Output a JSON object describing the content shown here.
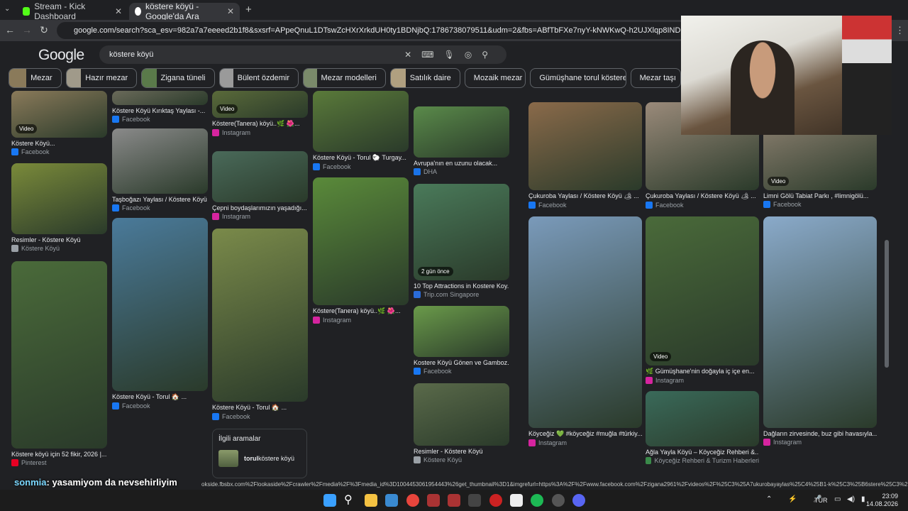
{
  "tabs": [
    {
      "label": "Stream - Kick Dashboard",
      "favicon_color": "#53fc18"
    },
    {
      "label": "köstere köyü - Google'da Ara",
      "favicon_color": "#ffffff"
    }
  ],
  "address": {
    "url": "google.com/search?sca_esv=982a7a7eeeed2b1f8&sxsrf=APpeQnuL1DTswZcHXrXrkdUH0ty1BDNjbQ:1786738079511&udm=2&fbs=ABfTbFXe7nyY-kNWKwQ-h2UJXlqp8INDCM9bT64ZSPFlq12ABgHn6ltrUBOgN"
  },
  "google": {
    "logo": "Google",
    "query": "köstere köyü"
  },
  "chips": [
    {
      "label": "Mezar",
      "color": "#8a7a5a"
    },
    {
      "label": "Hazır mezar",
      "color": "#a09a8a"
    },
    {
      "label": "Zigana tüneli",
      "color": "#5a7a4a"
    },
    {
      "label": "Bülent özdemir",
      "color": "#9a9a9a"
    },
    {
      "label": "Mezar modelleri",
      "color": "#7a8a6a"
    },
    {
      "label": "Satılık daire",
      "color": "#b0a080"
    },
    {
      "label": "Mozaik mezar",
      "color": ""
    },
    {
      "label": "Gümüşhane torul köstere",
      "color": ""
    },
    {
      "label": "Mezar taşı",
      "color": ""
    }
  ],
  "results": [
    {
      "title": "Köstere Köyü...",
      "source": "Facebook",
      "badge": "Video",
      "src_color": "#1877f2",
      "bg": "#8a7a5a"
    },
    {
      "title": "Resimler - Köstere Köyü",
      "source": "Köstere Köyü",
      "badge": "",
      "src_color": "#9aa0a6",
      "bg": "#7a8a3a"
    },
    {
      "title": "Köstere köyü için 52 fikir, 2026 |...",
      "source": "Pinterest",
      "badge": "",
      "src_color": "#e60023",
      "bg": "#4a6a3a"
    },
    {
      "title": "Köstere Köyü Kırıktaş Yaylası -...",
      "source": "Facebook",
      "badge": "",
      "src_color": "#1877f2",
      "bg": "#6a6a5a"
    },
    {
      "title": "Taşboğazı Yaylası / Köstere Köyü ...",
      "source": "Facebook",
      "badge": "",
      "src_color": "#1877f2",
      "bg": "#8a8a8a"
    },
    {
      "title": "Köstere Köyü - Torul 🏠 ...",
      "source": "Facebook",
      "badge": "",
      "src_color": "#1877f2",
      "bg": "#4a7a9a"
    },
    {
      "title": "Köstere(Tanera) köyü..🌿 🌺...",
      "source": "Instagram",
      "badge": "Video",
      "src_color": "#d6249f",
      "bg": "#5a6a3a"
    },
    {
      "title": "Çepni boydaşlarımızın yaşadığı...",
      "source": "Instagram",
      "badge": "",
      "src_color": "#d6249f",
      "bg": "#4a6a5a"
    },
    {
      "title": "Köstere Köyü - Torul 🏠 ...",
      "source": "Facebook",
      "badge": "",
      "src_color": "#1877f2",
      "bg": "#7a8a4a"
    },
    {
      "title": "Köstere Köyü - Torul 🐑 Turgay...",
      "source": "Facebook",
      "badge": "",
      "src_color": "#1877f2",
      "bg": "#5a7a3a"
    },
    {
      "title": "Köstere(Tanera) köyü..🌿 🌺...",
      "source": "Instagram",
      "badge": "",
      "src_color": "#d6249f",
      "bg": "#5a8a3a"
    },
    {
      "title": "Avrupa'nın en uzunu olacak...",
      "source": "DHA",
      "badge": "",
      "src_color": "#1a73e8",
      "bg": "#5a8a4a"
    },
    {
      "title": "10 Top Attractions in Kostere Koy...",
      "source": "Trip.com Singapore",
      "badge": "2 gün önce",
      "src_color": "#2a6bd9",
      "bg": "#4a7a5a"
    },
    {
      "title": "Kostere Köyü Gönen ve Gamboz...",
      "source": "Facebook",
      "badge": "",
      "src_color": "#1877f2",
      "bg": "#6a9a4a"
    },
    {
      "title": "Resimler - Köstere Köyü",
      "source": "Köstere Köyü",
      "badge": "",
      "src_color": "#9aa0a6",
      "bg": "#5a6a4a"
    },
    {
      "title": "Çukuroba Yaylası / Köstere Köyü 🏕 ...",
      "source": "Facebook",
      "badge": "",
      "src_color": "#1877f2",
      "bg": "#8a6a4a"
    },
    {
      "title": "Köyceğiz 💚 #köyceğiz #muğla #türkiy...",
      "source": "Instagram",
      "badge": "",
      "src_color": "#d6249f",
      "bg": "#7a9aba"
    },
    {
      "title": "Çukuroba Yaylası / Köstere Köyü 🏕 ...",
      "source": "Facebook",
      "badge": "",
      "src_color": "#1877f2",
      "bg": "#9a8a7a"
    },
    {
      "title": "🌿 Gümüşhane'nin doğayla iç içe en...",
      "source": "Instagram",
      "badge": "Video",
      "src_color": "#d6249f",
      "bg": "#4a6a3a"
    },
    {
      "title": "Ağla Yayla Köyü – Köyceğiz Rehberi &...",
      "source": "Köyceğiz Rehberi & Turizm Haberleri",
      "badge": "",
      "src_color": "#3a8a4a",
      "bg": "#3a6a5a"
    },
    {
      "title": "Limni Gölü Tabiat Parkı , #limnigölü...",
      "source": "Facebook",
      "badge": "Video",
      "src_color": "#1877f2",
      "bg": "#9a8a7a"
    },
    {
      "title": "Dağların zirvesinde, buz gibi havasıyla...",
      "source": "Instagram",
      "badge": "",
      "src_color": "#d6249f",
      "bg": "#8aaaca"
    }
  ],
  "related": {
    "heading": "İlgili aramalar",
    "item_bold": "torul",
    "item_rest": " köstere köyü"
  },
  "status_url": "okside.fbsbx.com%2Flookaside%2Fcrawler%2Fmedia%2F%3Fmedia_id%3D1004453061954443%26get_thumbnail%3D1&imgrefurl=https%3A%2F%2Fwww.facebook.com%2Fzigana2961%2Fvideos%2F%25C3%25A7ukurobayaylas%25C4%25B1-k%25C3%25B6stere%25C3%2...",
  "chat": {
    "user": "sonmia",
    "message": ": yasamiyom da nevsehirliyim"
  },
  "tray": {
    "lang": "TUR",
    "time": "23:09",
    "date": "14.08.2026"
  }
}
